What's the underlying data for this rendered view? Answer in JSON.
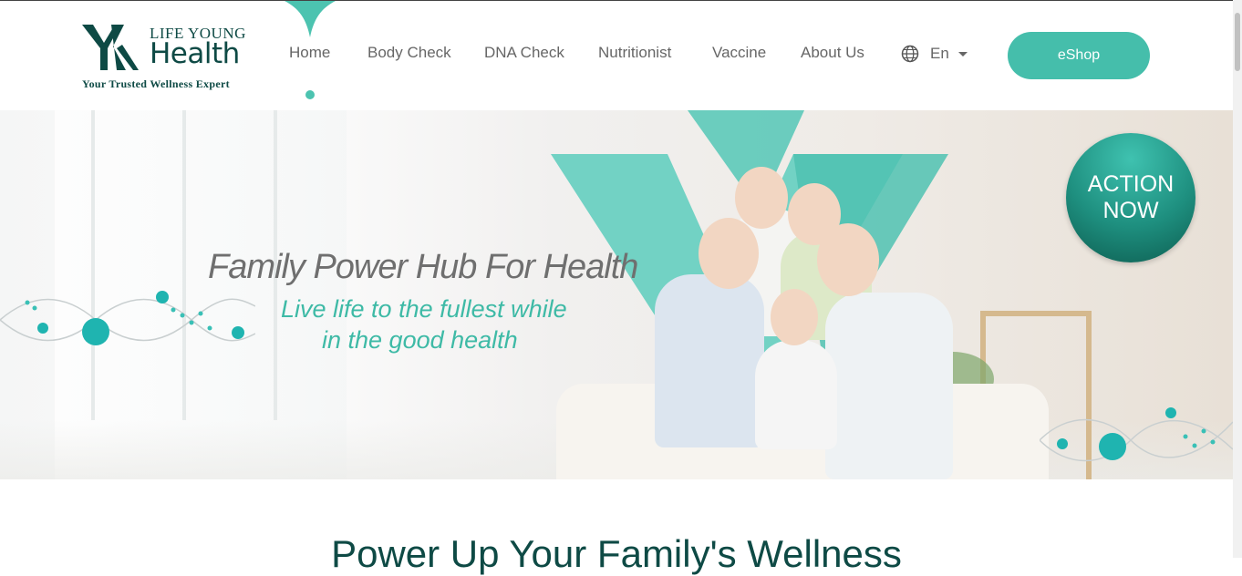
{
  "brand": {
    "line1": "LIFE YOUNG",
    "line2": "Health",
    "tagline": "Your Trusted Wellness Expert",
    "accent": "#45beab",
    "dark": "#0e4a45"
  },
  "nav": {
    "items": [
      {
        "label": "Home",
        "active": true
      },
      {
        "label": "Body Check"
      },
      {
        "label": "DNA Check"
      },
      {
        "label": "Nutritionist"
      },
      {
        "label": "Vaccine"
      },
      {
        "label": "About Us"
      }
    ],
    "language": {
      "label": "En",
      "icon": "globe-icon"
    },
    "eshop_label": "eShop"
  },
  "hero": {
    "title": "Family Power Hub For Health",
    "subtitle_line1": "Live life to the fullest while",
    "subtitle_line2": "in the good health",
    "cta_line1": "ACTION",
    "cta_line2": "NOW"
  },
  "section": {
    "title": "Power Up Your Family's Wellness"
  }
}
